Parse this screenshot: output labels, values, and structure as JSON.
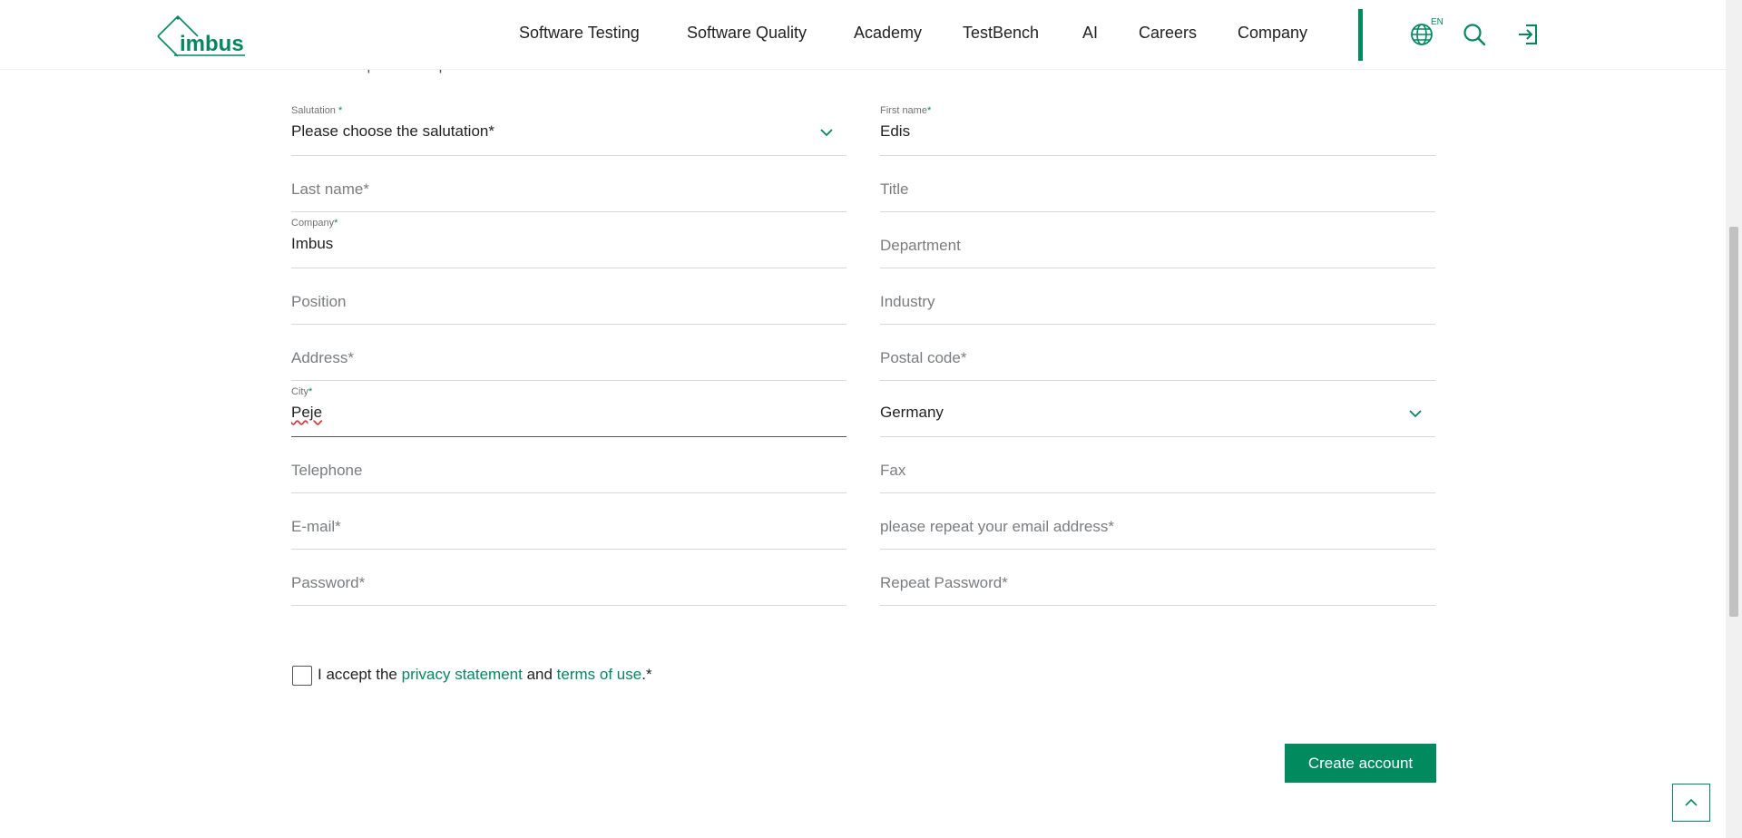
{
  "header": {
    "logo_text": "imbus",
    "nav": [
      "Software Testing",
      "Software Quality",
      "Academy",
      "TestBench",
      "AI",
      "Careers",
      "Company"
    ],
    "language": "EN",
    "icons": [
      "globe-icon",
      "search-icon",
      "login-icon"
    ]
  },
  "form": {
    "intro_cut_text": "Please complete all required fields",
    "salutation": {
      "label": "Salutation",
      "required_mark": "*",
      "value": "Please choose the salutation*"
    },
    "first_name": {
      "label": "First name",
      "required_mark": "*",
      "value": "Edis"
    },
    "last_name": {
      "placeholder": "Last name*"
    },
    "title": {
      "placeholder": "Title"
    },
    "company": {
      "label": "Company",
      "required_mark": "*",
      "value": "Imbus"
    },
    "department": {
      "placeholder": "Department"
    },
    "position": {
      "placeholder": "Position"
    },
    "industry": {
      "placeholder": "Industry"
    },
    "address": {
      "placeholder": "Address*"
    },
    "postal_code": {
      "placeholder": "Postal code*"
    },
    "city": {
      "label": "City",
      "required_mark": "*",
      "value": "Peje"
    },
    "country": {
      "value": "Germany"
    },
    "telephone": {
      "placeholder": "Telephone"
    },
    "fax": {
      "placeholder": "Fax"
    },
    "email": {
      "placeholder": "E-mail*"
    },
    "email_repeat": {
      "placeholder": "please repeat your email address*"
    },
    "password": {
      "placeholder": "Password*"
    },
    "password_repeat": {
      "placeholder": "Repeat Password*"
    },
    "consent": {
      "prefix": "I accept the ",
      "privacy_link": "privacy statement",
      "middle": " and ",
      "terms_link": "terms of use",
      "suffix": ".*"
    },
    "submit_label": "Create account"
  },
  "colors": {
    "brand": "#008a5e",
    "text": "#222222",
    "placeholder": "#7a7d80",
    "line": "#d6d9da"
  }
}
